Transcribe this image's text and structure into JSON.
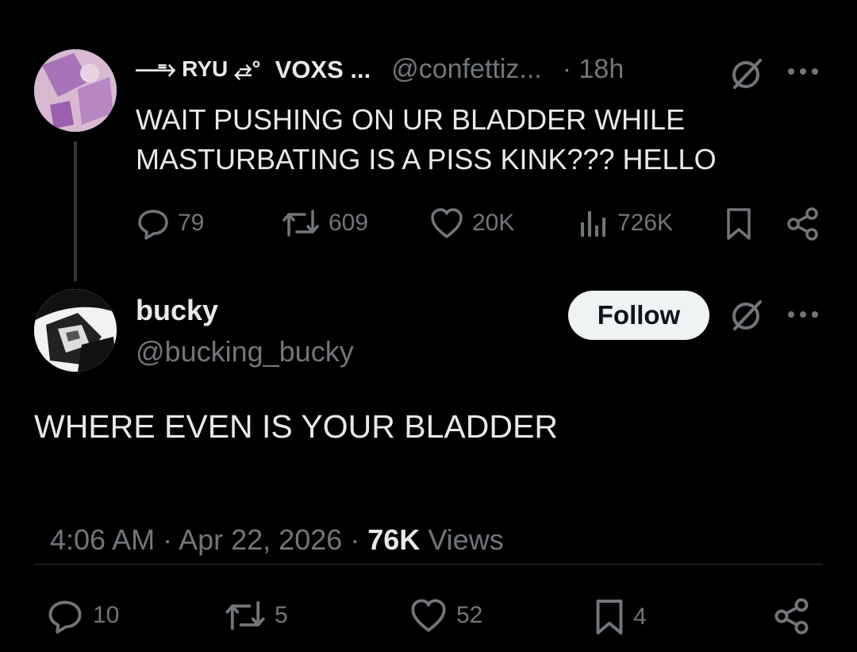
{
  "parent_tweet": {
    "display_name_prefix": "—⥱ RYU ⥄°",
    "display_name": "VOXS ...",
    "handle": "@confettiz...",
    "time": "· 18h",
    "text_line1": "WAIT PUSHING ON UR BLADDER WHILE",
    "text_line2": "MASTURBATING IS A PISS KINK??? HELLO",
    "replies": "79",
    "reposts": "609",
    "likes": "20K",
    "views": "726K"
  },
  "reply_tweet": {
    "display_name": "bucky",
    "handle": "@bucking_bucky",
    "follow_label": "Follow",
    "text": "WHERE EVEN IS YOUR BLADDER",
    "timestamp": "4:06 AM · Apr 22, 2026 · ",
    "views_count": "76K",
    "views_label": " Views",
    "replies": "10",
    "reposts": "5",
    "likes": "52",
    "bookmarks": "4"
  },
  "colors": {
    "background": "#000000",
    "text": "#e7e9ea",
    "muted": "#71767b",
    "follow_bg": "#eff3f4"
  }
}
